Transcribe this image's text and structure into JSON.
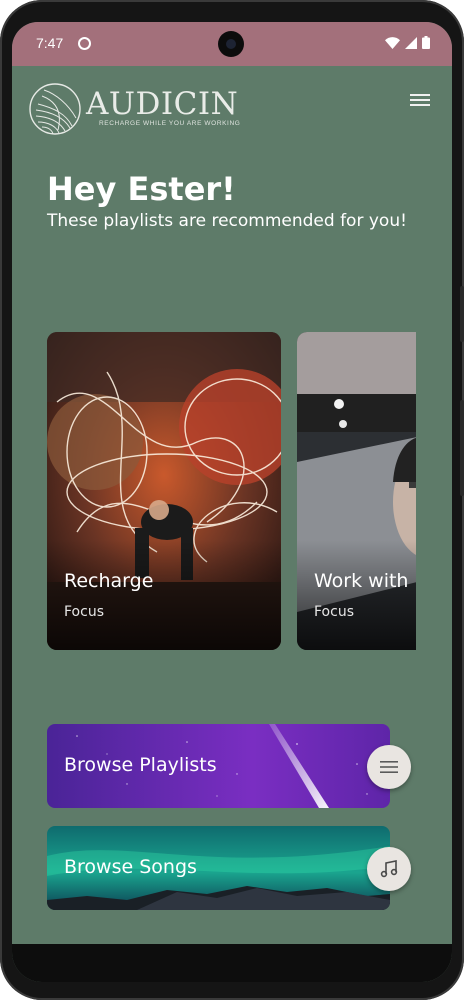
{
  "status_bar": {
    "time": "7:47",
    "background_color": "#a3707b",
    "icons": [
      "notification-dot-icon",
      "wifi-icon",
      "signal-icon",
      "battery-icon"
    ]
  },
  "header": {
    "brand": "AUDICIN",
    "tagline": "RECHARGE WHILE YOU ARE WORKING",
    "menu_icon": "hamburger-menu-icon"
  },
  "greeting": {
    "title": "Hey Ester!",
    "subtitle": "These playlists are recommended for you!"
  },
  "playlists": [
    {
      "title": "Recharge",
      "category": "Focus"
    },
    {
      "title": "Work with",
      "category": "Focus"
    }
  ],
  "browse": {
    "playlists_label": "Browse Playlists",
    "playlists_icon": "list-icon",
    "songs_label": "Browse Songs",
    "songs_icon": "music-note-icon"
  },
  "colors": {
    "background": "#5e7b69",
    "status_bar": "#a3707b",
    "fab": "#e9e5e1"
  }
}
